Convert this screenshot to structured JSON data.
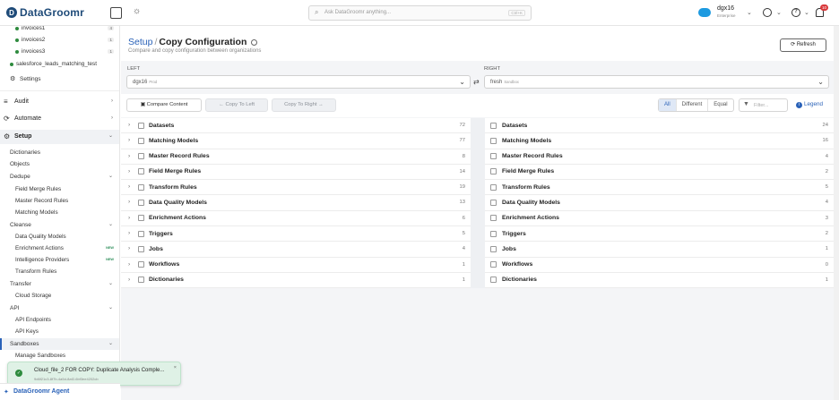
{
  "app": {
    "brand": "DataGroomr",
    "logo_letter": "D"
  },
  "topbar": {
    "search_placeholder": "Ask DataGroomr anything...",
    "search_shortcut": "Ctrl+K",
    "user_name": "dgx16",
    "user_plan": "Enterprise",
    "help_glyph": "?",
    "notification_count": "10"
  },
  "sidebar": {
    "files": [
      {
        "label": "invoices1",
        "count": "4"
      },
      {
        "label": "invoices2",
        "count": "1"
      },
      {
        "label": "invoices3",
        "count": "1"
      }
    ],
    "file4": "salesforce_leads_matching_test",
    "settings": "Settings",
    "audit": "Audit",
    "automate": "Automate",
    "setup": "Setup",
    "dictionaries": "Dictionaries",
    "objects": "Objects",
    "dedupe": "Dedupe",
    "field_merge_rules": "Field Merge Rules",
    "master_record_rules": "Master Record Rules",
    "matching_models": "Matching Models",
    "cleanse": "Cleanse",
    "data_quality_models": "Data Quality Models",
    "enrichment_actions": "Enrichment Actions",
    "intelligence_providers": "Intelligence Providers",
    "transform_rules": "Transform Rules",
    "new_badge": "NEW",
    "transfer": "Transfer",
    "cloud_storage": "Cloud Storage",
    "api": "API",
    "api_endpoints": "API Endpoints",
    "api_keys": "API Keys",
    "sandboxes": "Sandboxes",
    "manage_sandboxes": "Manage Sandboxes",
    "agent": "DataGroomr Agent"
  },
  "page": {
    "crumb_parent": "Setup",
    "crumb_sep": "/",
    "title": "Copy Configuration",
    "subtitle": "Compare and copy configuration between organizations",
    "refresh": "Refresh",
    "left_label": "LEFT",
    "right_label": "RIGHT",
    "left_org": "dgx16",
    "left_org_tag": "Prod",
    "right_org": "fresh",
    "right_org_tag": "Sandbox",
    "compare_btn": "Compare Content",
    "copy_left_btn": "Copy To Left",
    "copy_right_btn": "Copy To Right",
    "filter_all": "All",
    "filter_different": "Different",
    "filter_equal": "Equal",
    "filter_placeholder": "Filter...",
    "legend": "Legend"
  },
  "left_rows": [
    {
      "name": "Datasets",
      "count": "72"
    },
    {
      "name": "Matching Models",
      "count": "77"
    },
    {
      "name": "Master Record Rules",
      "count": "8"
    },
    {
      "name": "Field Merge Rules",
      "count": "14"
    },
    {
      "name": "Transform Rules",
      "count": "19"
    },
    {
      "name": "Data Quality Models",
      "count": "13"
    },
    {
      "name": "Enrichment Actions",
      "count": "6"
    },
    {
      "name": "Triggers",
      "count": "5"
    },
    {
      "name": "Jobs",
      "count": "4"
    },
    {
      "name": "Workflows",
      "count": "1"
    },
    {
      "name": "Dictionaries",
      "count": "1"
    }
  ],
  "right_rows": [
    {
      "name": "Datasets",
      "count": "24"
    },
    {
      "name": "Matching Models",
      "count": "16"
    },
    {
      "name": "Master Record Rules",
      "count": "4"
    },
    {
      "name": "Field Merge Rules",
      "count": "2"
    },
    {
      "name": "Transform Rules",
      "count": "5"
    },
    {
      "name": "Data Quality Models",
      "count": "4"
    },
    {
      "name": "Enrichment Actions",
      "count": "3"
    },
    {
      "name": "Triggers",
      "count": "2"
    },
    {
      "name": "Jobs",
      "count": "1"
    },
    {
      "name": "Workflows",
      "count": "0"
    },
    {
      "name": "Dictionaries",
      "count": "1"
    }
  ],
  "toast": {
    "title": "Cloud_file_2 FOR COPY: Duplicate Analysis Comple...",
    "id": "9d6f21c3-8f7b-4a5d-8af2-6bf3ee4202cb",
    "close": "×"
  }
}
